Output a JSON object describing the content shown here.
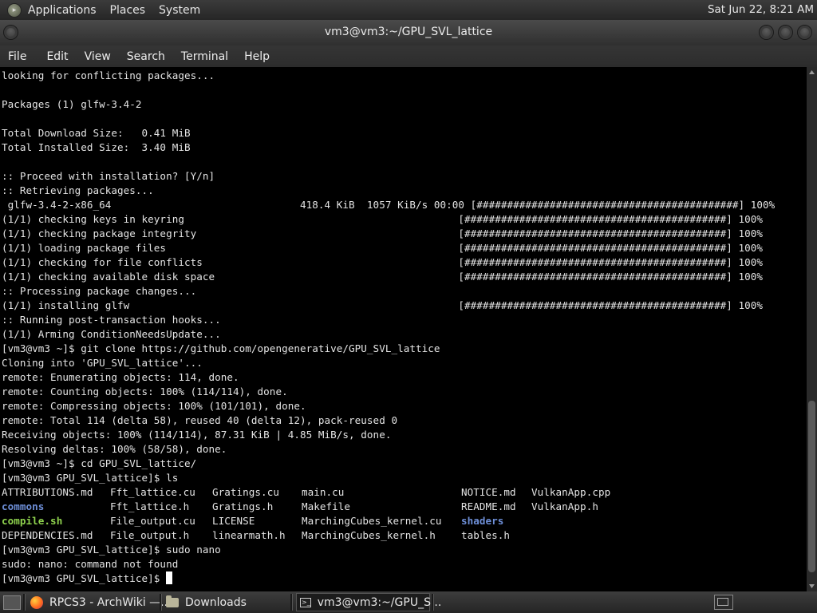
{
  "top_panel": {
    "menus": [
      "Applications",
      "Places",
      "System"
    ],
    "clock": "Sat Jun 22,  8:21 AM"
  },
  "window": {
    "title": "vm3@vm3:~/GPU_SVL_lattice"
  },
  "menubar": [
    "File",
    "Edit",
    "View",
    "Search",
    "Terminal",
    "Help"
  ],
  "terminal": {
    "lines": [
      [
        {
          "t": "looking for conflicting packages..."
        }
      ],
      [],
      [
        {
          "t": "Packages (1) glfw-3.4-2"
        }
      ],
      [],
      [
        {
          "t": "Total Download Size:   0.41 MiB"
        }
      ],
      [
        {
          "t": "Total Installed Size:  3.40 MiB"
        }
      ],
      [],
      [
        {
          "t": ":: Proceed with installation? [Y/n]"
        }
      ],
      [
        {
          "t": ":: Retrieving packages..."
        }
      ],
      [
        {
          "t": " glfw-3.4-2-x86_64                               418.4 KiB  1057 KiB/s 00:00 [###########################################] 100%"
        }
      ],
      [
        {
          "t": "(1/1) checking keys in keyring                                             [###########################################] 100%"
        }
      ],
      [
        {
          "t": "(1/1) checking package integrity                                           [###########################################] 100%"
        }
      ],
      [
        {
          "t": "(1/1) loading package files                                                [###########################################] 100%"
        }
      ],
      [
        {
          "t": "(1/1) checking for file conflicts                                          [###########################################] 100%"
        }
      ],
      [
        {
          "t": "(1/1) checking available disk space                                        [###########################################] 100%"
        }
      ],
      [
        {
          "t": ":: Processing package changes..."
        }
      ],
      [
        {
          "t": "(1/1) installing glfw                                                      [###########################################] 100%"
        }
      ],
      [
        {
          "t": ":: Running post-transaction hooks..."
        }
      ],
      [
        {
          "t": "(1/1) Arming ConditionNeedsUpdate..."
        }
      ],
      [
        {
          "t": "[vm3@vm3 ~]$ git clone https://github.com/opengenerative/GPU_SVL_lattice"
        }
      ],
      [
        {
          "t": "Cloning into 'GPU_SVL_lattice'..."
        }
      ],
      [
        {
          "t": "remote: Enumerating objects: 114, done."
        }
      ],
      [
        {
          "t": "remote: Counting objects: 100% (114/114), done."
        }
      ],
      [
        {
          "t": "remote: Compressing objects: 100% (101/101), done."
        }
      ],
      [
        {
          "t": "remote: Total 114 (delta 58), reused 40 (delta 12), pack-reused 0"
        }
      ],
      [
        {
          "t": "Receiving objects: 100% (114/114), 87.31 KiB | 4.85 MiB/s, done."
        }
      ],
      [
        {
          "t": "Resolving deltas: 100% (58/58), done."
        }
      ],
      [
        {
          "t": "[vm3@vm3 ~]$ cd GPU_SVL_lattice/"
        }
      ],
      [
        {
          "t": "[vm3@vm3 GPU_SVL_lattice]$ ls"
        }
      ],
      [
        {
          "t": "ATTRIBUTIONS.md",
          "col": 0
        },
        {
          "t": "Fft_lattice.cu",
          "col": 17
        },
        {
          "t": "Gratings.cu",
          "col": 33
        },
        {
          "t": "main.cu",
          "col": 47
        },
        {
          "t": "NOTICE.md",
          "col": 72
        },
        {
          "t": "VulkanApp.cpp",
          "col": 83
        }
      ],
      [
        {
          "t": "commons",
          "c": "dir",
          "col": 0
        },
        {
          "t": "Fft_lattice.h",
          "col": 17
        },
        {
          "t": "Gratings.h",
          "col": 33
        },
        {
          "t": "Makefile",
          "col": 47
        },
        {
          "t": "README.md",
          "col": 72
        },
        {
          "t": "VulkanApp.h",
          "col": 83
        }
      ],
      [
        {
          "t": "compile.sh",
          "c": "exe",
          "col": 0
        },
        {
          "t": "File_output.cu",
          "col": 17
        },
        {
          "t": "LICENSE",
          "col": 33
        },
        {
          "t": "MarchingCubes_kernel.cu",
          "col": 47
        },
        {
          "t": "shaders",
          "c": "dir",
          "col": 72
        }
      ],
      [
        {
          "t": "DEPENDENCIES.md",
          "col": 0
        },
        {
          "t": "File_output.h",
          "col": 17
        },
        {
          "t": "linearmath.h",
          "col": 33
        },
        {
          "t": "MarchingCubes_kernel.h",
          "col": 47
        },
        {
          "t": "tables.h",
          "col": 72
        }
      ],
      [
        {
          "t": "[vm3@vm3 GPU_SVL_lattice]$ sudo nano"
        }
      ],
      [
        {
          "t": "sudo: nano: command not found"
        }
      ],
      [
        {
          "t": "[vm3@vm3 GPU_SVL_lattice]$ "
        },
        {
          "cursor": true
        }
      ]
    ]
  },
  "taskbar": {
    "items": [
      {
        "label": "RPCS3 - ArchWiki —...",
        "icon": "firefox-icon"
      },
      {
        "label": "Downloads",
        "icon": "folder-icon"
      },
      {
        "label": "vm3@vm3:~/GPU_S...",
        "icon": "terminal-icon",
        "active": true
      }
    ]
  }
}
